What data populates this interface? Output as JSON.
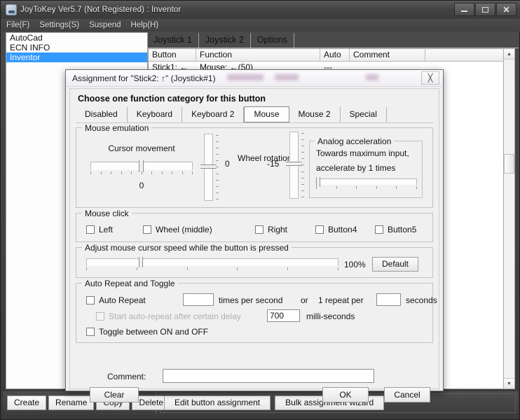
{
  "window": {
    "title": "JoyToKey Ver5.7 (Not Registered) : Inventor",
    "icon": "joystick-icon",
    "controls": {
      "minimize": "minimize-icon",
      "maximize": "maximize-icon",
      "close": "close-icon"
    }
  },
  "menubar": {
    "items": [
      "File(F)",
      "Settings(S)",
      "Suspend",
      "Help(H)"
    ]
  },
  "profiles": {
    "items": [
      {
        "label": "AutoCad",
        "selected": false
      },
      {
        "label": "ECN INFO",
        "selected": false
      },
      {
        "label": "Inventor",
        "selected": true
      }
    ]
  },
  "tabs": [
    {
      "label": "Joystick 1",
      "active": true
    },
    {
      "label": "Joystick 2",
      "active": false
    },
    {
      "label": "Options",
      "active": false
    }
  ],
  "grid": {
    "columns": [
      "Button",
      "Function",
      "Auto",
      "Comment",
      ""
    ],
    "rows": [
      {
        "button": "Stick1: ←",
        "function": "Mouse: ←(50)",
        "auto": "---",
        "comment": ""
      }
    ]
  },
  "bottom_toolbar": {
    "left_buttons": [
      "Create",
      "Rename",
      "Copy",
      "Delete"
    ],
    "right_buttons": [
      "Edit button assignment",
      "Bulk assignment wizard"
    ]
  },
  "dialog": {
    "title": "Assignment for \"Stick2: ↑\" (Joystick#1)",
    "close_icon": "close-icon",
    "heading": "Choose one function category for this button",
    "category_tabs": [
      {
        "label": "Disabled",
        "selected": false
      },
      {
        "label": "Keyboard",
        "selected": false
      },
      {
        "label": "Keyboard 2",
        "selected": false
      },
      {
        "label": "Mouse",
        "selected": true
      },
      {
        "label": "Mouse 2",
        "selected": false
      },
      {
        "label": "Special",
        "selected": false
      }
    ],
    "mouse_emulation": {
      "legend": "Mouse emulation",
      "cursor_movement": {
        "label": "Cursor movement",
        "value": "0"
      },
      "vertical_cursor": {
        "value": "0"
      },
      "wheel_rotation": {
        "label": "Wheel rotation",
        "value": "-15"
      },
      "analog_acceleration": {
        "legend": "Analog acceleration",
        "line1": "Towards maximum input,",
        "line2": "accelerate by 1 times"
      }
    },
    "mouse_click": {
      "legend": "Mouse click",
      "checkboxes": [
        {
          "label": "Left",
          "checked": false
        },
        {
          "label": "Wheel (middle)",
          "checked": false
        },
        {
          "label": "Right",
          "checked": false
        },
        {
          "label": "Button4",
          "checked": false
        },
        {
          "label": "Button5",
          "checked": false
        }
      ]
    },
    "cursor_speed": {
      "legend": "Adjust mouse cursor speed while the button is pressed",
      "value": "100%",
      "default_button": "Default"
    },
    "auto_repeat": {
      "legend": "Auto Repeat and Toggle",
      "auto_repeat_label": "Auto Repeat",
      "auto_repeat_checked": false,
      "rate_value": "",
      "times_per_second_label": "times per second",
      "or_label": "or",
      "one_repeat_per_label": "1 repeat per",
      "seconds_value": "",
      "seconds_label": "seconds",
      "delay_label": "Start auto-repeat after certain delay",
      "delay_checked": false,
      "delay_value": "700",
      "milliseconds_label": "milli-seconds",
      "toggle_label": "Toggle between ON and OFF",
      "toggle_checked": false
    },
    "comment": {
      "label": "Comment:",
      "value": "",
      "placeholder": ""
    },
    "buttons": {
      "clear": "Clear",
      "ok": "OK",
      "cancel": "Cancel"
    }
  },
  "colors": {
    "selection": "#3399ff",
    "dialog_bg": "#f0f0f0",
    "chrome": "#434343"
  }
}
